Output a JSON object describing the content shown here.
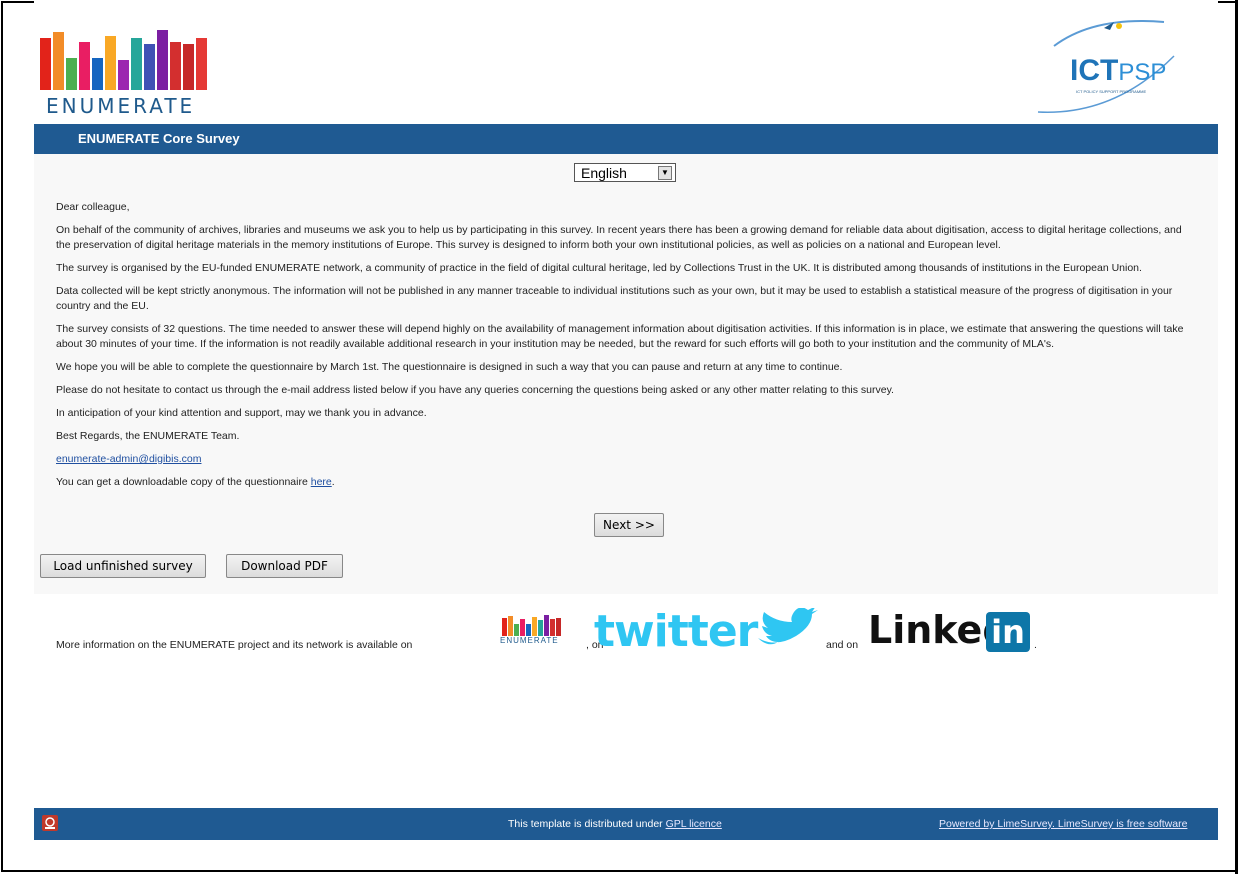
{
  "header": {
    "logo_text": "ENUMERATE",
    "partner_logo_main": "ICT",
    "partner_logo_sub": "PSP",
    "partner_logo_small": "ICT POLICY SUPPORT PROGRAMME"
  },
  "titlebar": {
    "title": "ENUMERATE Core Survey"
  },
  "language_select": {
    "selected": "English"
  },
  "body": {
    "greeting": "Dear colleague,",
    "p1": "On behalf of the community of archives, libraries and museums we ask you to help us by participating in this survey. In recent years there has been a growing demand for reliable data about digitisation, access to digital heritage collections, and the preservation of digital heritage materials in the memory institutions of Europe. This survey is designed to inform both your own institutional policies, as well as policies on a national and European level.",
    "p2": "The survey is organised by the EU-funded ENUMERATE network, a community of practice in the field of digital cultural heritage, led by Collections Trust in the UK. It is distributed among thousands of institutions in the European Union.",
    "p3": "Data collected will be kept strictly anonymous. The information will not be published in any manner traceable to individual institutions such as your own, but it may be used to establish a statistical measure of the progress of digitisation in your country and the EU.",
    "p4": "The survey consists of 32 questions. The time needed to answer these will depend highly on the availability of management information about digitisation activities. If this information is in place, we estimate that answering the questions will take about 30 minutes of your time. If the information is not readily available additional research in your institution may be needed, but the reward for such efforts will go both to your institution and the community of MLA's.",
    "p5": "We hope you will be able to complete the questionnaire by March 1st. The questionnaire is designed in such a way that you can pause and return at any time to continue.",
    "p6": "Please do not hesitate to contact us through the e-mail address listed below if you have any queries concerning the questions being asked or any other matter relating to this survey.",
    "p7": "In anticipation of your kind attention and support, may we thank you in advance.",
    "p8": "Best Regards, the ENUMERATE Team.",
    "email": "enumerate-admin@digibis.com",
    "download_prefix": "You can get a downloadable copy of the questionnaire",
    "download_link": "here",
    "download_suffix": "."
  },
  "more_info": {
    "text": "More information on the ENUMERATE project and its network is available on",
    "mini_logo_text": "ENUMERATE",
    "on1": ", on",
    "twitter": "twitter",
    "on2": "and on",
    "linkedin": "Linked",
    "linkedin_in": "in",
    "end": "."
  },
  "buttons": {
    "next": "Next >>",
    "load": "Load unfinished survey",
    "pdf": "Download PDF"
  },
  "footer": {
    "licence_text": "This template is distributed under",
    "licence_link": "GPL licence",
    "powered": "Powered by LimeSurvey. LimeSurvey is free software"
  },
  "colors": {
    "bar_blue": "#1f5a92",
    "twitter_blue": "#2fc6f2",
    "linkedin_blue": "#0e76a8"
  },
  "icons": {
    "footer_logo": "digibis-icon",
    "twitter_bird": "twitter-bird-icon"
  }
}
